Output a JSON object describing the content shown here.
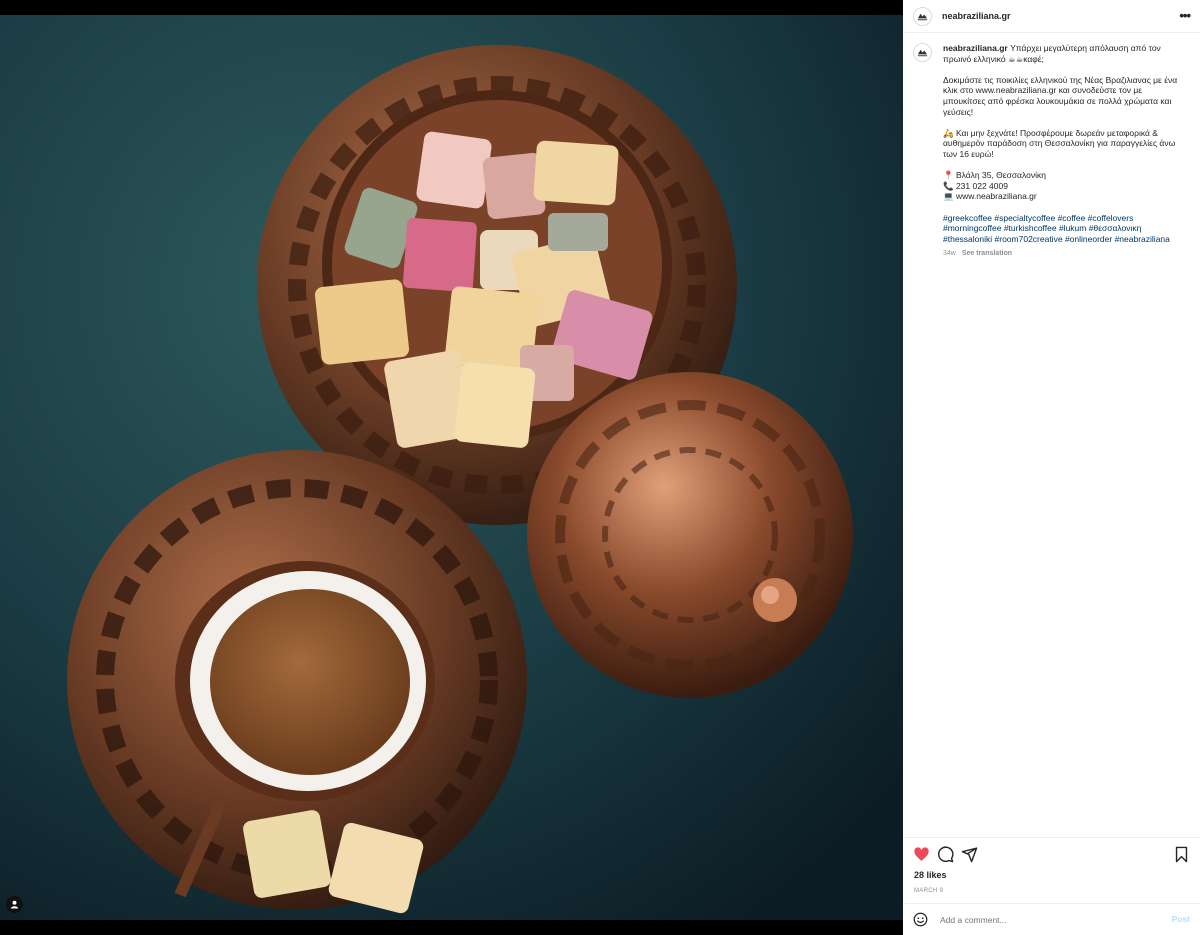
{
  "colors": {
    "accent": "#0095f6",
    "like": "#ed4956",
    "text": "#262626",
    "muted": "#8e8e8e",
    "link": "#00376b"
  },
  "photo": {
    "alt_icon": "user-tag-icon",
    "subject": "image"
  },
  "header": {
    "username": "neabraziliana.gr",
    "more_icon": "more-horizontal-icon",
    "more_label": "•••"
  },
  "caption": {
    "username": "neabraziliana.gr",
    "lead": " Υπάρχει μεγαλύτερη απόλαυση από τον πρωινό ελληνικό ☕☕καφέ;",
    "para2": "Δοκιμάστε τις ποικιλίες ελληνικού της Νέας Βραζιλιανας με ένα κλικ στο www.neabraziliana.gr και συνοδεύστε τον με μπουκίτσες από φρέσκα λουκουμάκια σε πολλά χρώματα και γεύσεις!",
    "para3": "🛵 Και μην ξεχνάτε! Προσφέρουμε δωρεάν μεταφορικά & αυθημερόν παράδοση στη Θεσσαλονίκη για παραγγελίες άνω των 16 ευρώ!",
    "address": "📍 Βλάλη 35, Θεσσαλονίκη",
    "phone": "📞 231 022 4009",
    "website": "💻 www.neabraziliana.gr",
    "hashtags": [
      "#greekcoffee",
      "#specialtycoffee",
      "#coffee",
      "#coffelovers",
      "#morningcoffee",
      "#turkishcoffee",
      "#lukum",
      "#θεσσαλονικη",
      "#thessaloniki",
      "#room702creative",
      "#onlineorder",
      "#neabraziliana"
    ],
    "age": "34w",
    "translate": "See translation"
  },
  "actions": {
    "like_icon": "heart-filled-icon",
    "comment_icon": "comment-icon",
    "share_icon": "share-icon",
    "save_icon": "bookmark-icon"
  },
  "likes": "28 likes",
  "date": "MARCH 9",
  "comment": {
    "emoji_icon": "emoji-icon",
    "placeholder": "Add a comment...",
    "post_label": "Post"
  }
}
